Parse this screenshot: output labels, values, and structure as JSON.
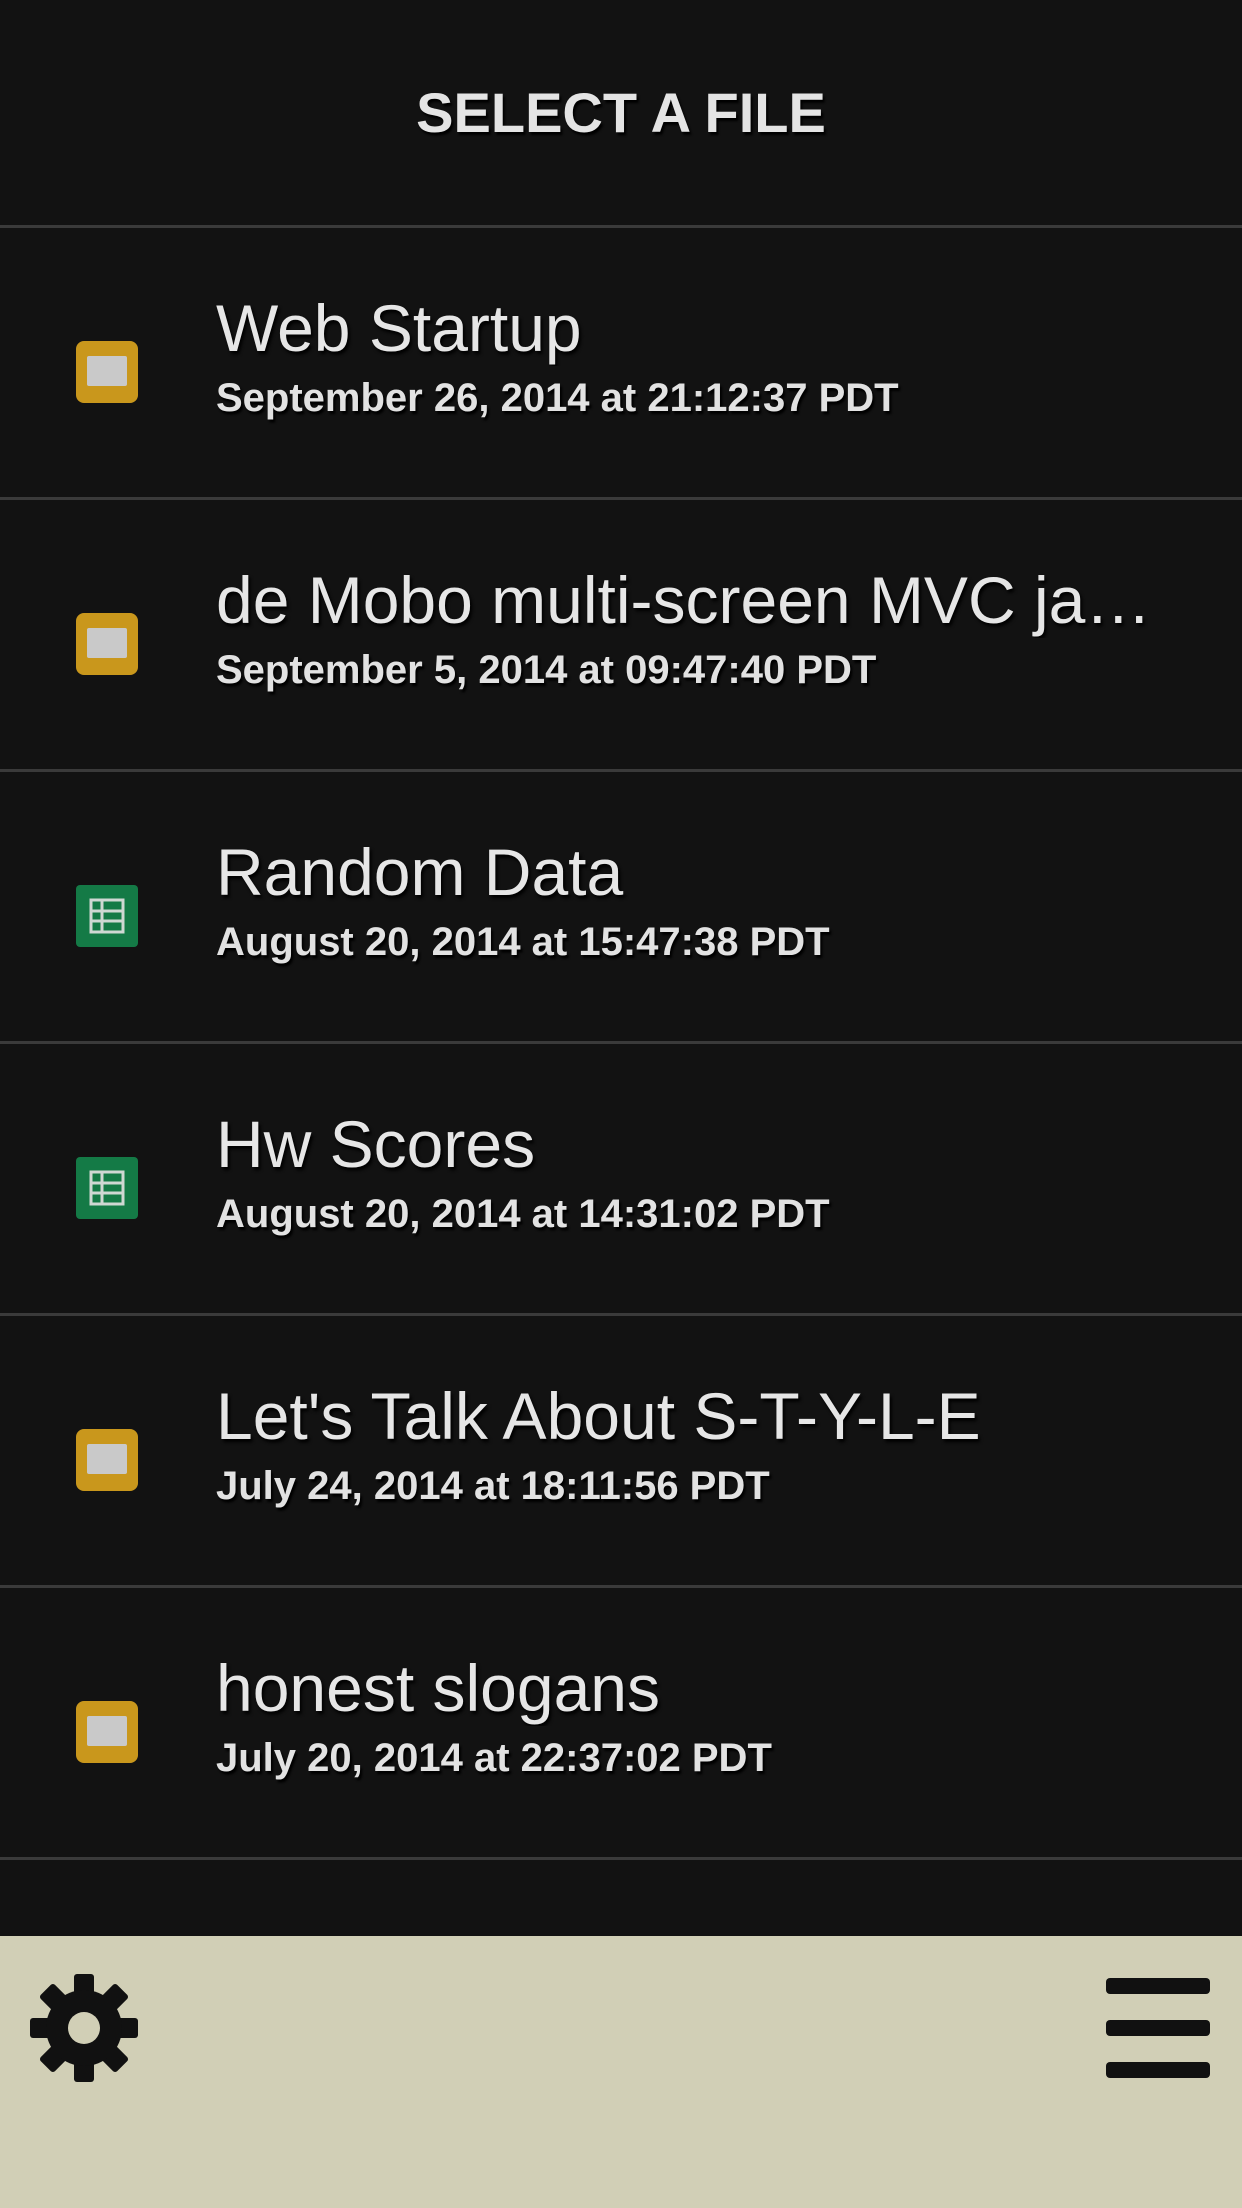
{
  "header": {
    "title": "SELECT A FILE"
  },
  "files": [
    {
      "title": "Web Startup",
      "date": "September 26, 2014 at 21:12:37 PDT",
      "type": "slides"
    },
    {
      "title": "de Mobo multi-screen MVC ja…",
      "date": "September 5, 2014 at 09:47:40 PDT",
      "type": "slides"
    },
    {
      "title": "Random Data",
      "date": "August 20, 2014 at 15:47:38 PDT",
      "type": "sheets"
    },
    {
      "title": "Hw Scores",
      "date": "August 20, 2014 at 14:31:02 PDT",
      "type": "sheets"
    },
    {
      "title": "Let's Talk About S-T-Y-L-E",
      "date": "July 24, 2014 at 18:11:56 PDT",
      "type": "slides"
    },
    {
      "title": "honest slogans",
      "date": "July 20, 2014 at 22:37:02 PDT",
      "type": "slides"
    }
  ],
  "icons": {
    "slides": "slides-file-icon",
    "sheets": "sheets-file-icon",
    "settings": "gear-icon",
    "menu": "hamburger-menu-icon"
  },
  "colors": {
    "background": "#121212",
    "divider": "#3a3a3a",
    "slides": "#c9971c",
    "sheets": "#147a46",
    "footer": "#d1cfb6"
  }
}
